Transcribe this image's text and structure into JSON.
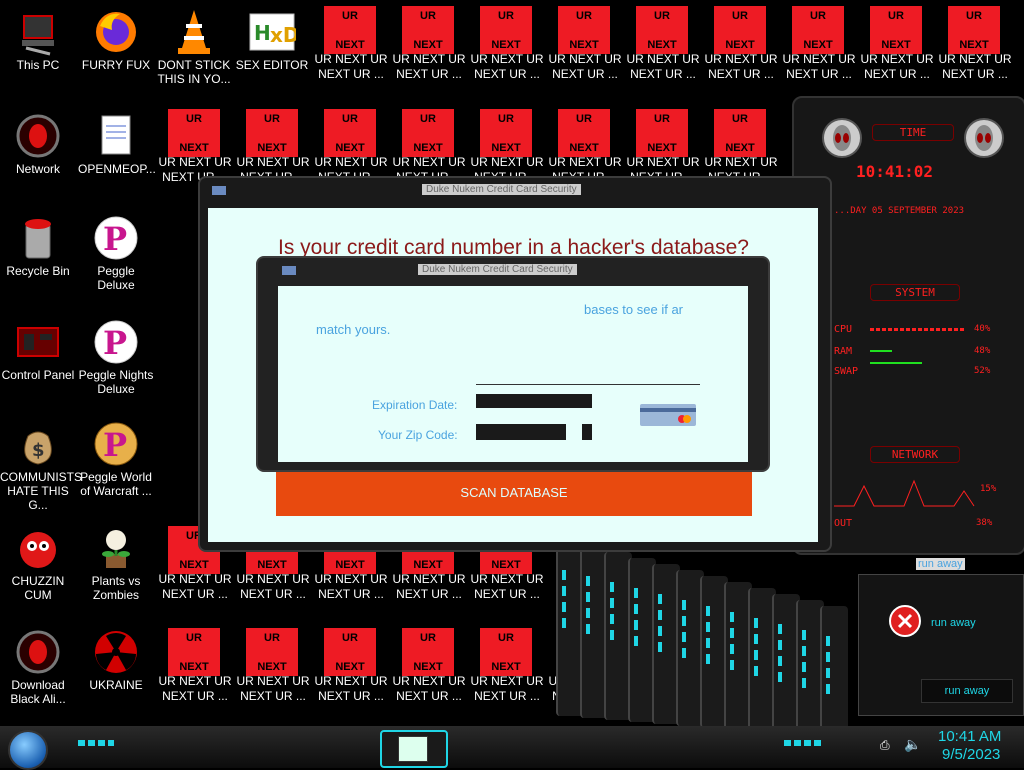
{
  "desktop_left": [
    {
      "label": "This PC",
      "icon": "computer-icon"
    },
    {
      "label": "FURRY FUX",
      "icon": "firefox-icon"
    },
    {
      "label": "DONT STICK THIS IN YO...",
      "icon": "vlc-cone-icon"
    },
    {
      "label": "SEX EDITOR",
      "icon": "hxd-editor-icon"
    },
    {
      "label": "Network",
      "icon": "network-alien-icon"
    },
    {
      "label": "OPENMEOP...",
      "icon": "document-icon"
    },
    {
      "label": "Recycle Bin",
      "icon": "recycle-bin-icon"
    },
    {
      "label": "Peggle Deluxe",
      "icon": "peggle-icon"
    },
    {
      "label": "Control Panel",
      "icon": "control-panel-icon"
    },
    {
      "label": "Peggle Nights Deluxe",
      "icon": "peggle-icon"
    },
    {
      "label": "COMMUNISTS HATE THIS G...",
      "icon": "money-bag-icon"
    },
    {
      "label": "Peggle World of Warcraft ...",
      "icon": "peggle-icon"
    },
    {
      "label": "CHUZZIN CUM",
      "icon": "chuzzle-icon"
    },
    {
      "label": "Plants vs Zombies",
      "icon": "plant-icon"
    },
    {
      "label": "Download Black Ali...",
      "icon": "alien-download-icon"
    },
    {
      "label": "UKRAINE",
      "icon": "radiation-icon"
    }
  ],
  "ur_tile": {
    "top": "UR",
    "bottom": "NEXT",
    "label": "UR NEXT UR NEXT UR ...",
    "label_short": "UR NEXT UR",
    "label_partial": "UR NEXT UR NEXT"
  },
  "widgets": {
    "time_title": "TIME",
    "clock": "10:41:02",
    "date": "...DAY 05 SEPTEMBER 2023",
    "system_title": "SYSTEM",
    "cpu_label": "CPU",
    "cpu_val": "40%",
    "ram_label": "RAM",
    "ram_val": "48%",
    "swap_label": "SWAP",
    "swap_val": "52%",
    "network_title": "NETWORK",
    "net_in": "15%",
    "net_out_label": "OUT",
    "net_out": "38%"
  },
  "scam_window": {
    "title": "Duke Nukem Credit Card Security",
    "heading": "Is your credit card number in a hacker's database?",
    "scan_button": "SCAN DATABASE"
  },
  "front_window": {
    "title": "Duke Nukem Credit Card Security",
    "text_line1_partial": "bases to see if ar",
    "text_line2": "match yours.",
    "expiration_label": "Expiration Date:",
    "zip_label": "Your Zip Code:"
  },
  "run_away": {
    "title_label": "run away",
    "message": "run away",
    "button": "run away"
  },
  "taskbar": {
    "time": "10:41 AM",
    "date": "9/5/2023"
  },
  "colors": {
    "tile_red": "#ee1b24",
    "scam_bg": "#e7fffb",
    "heading_red": "#8b1a1a",
    "scan_orange": "#e84a0f",
    "link_blue": "#4aa3df",
    "alien_red": "#ff2020",
    "cyan_accent": "#1fd6e6"
  }
}
